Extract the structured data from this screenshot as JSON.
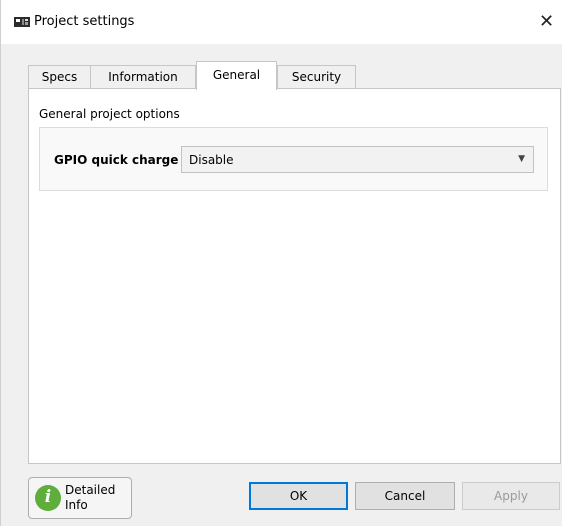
{
  "window": {
    "title": "Project settings",
    "close_glyph": "✕",
    "icon": "chip-board-icon"
  },
  "tabs": [
    {
      "label": "Specs",
      "active": false
    },
    {
      "label": "Information",
      "active": false
    },
    {
      "label": "General",
      "active": true
    },
    {
      "label": "Security",
      "active": false
    }
  ],
  "general": {
    "group_title": "General project options",
    "gpio_label": "GPIO quick charge",
    "gpio_value": "Disable"
  },
  "footer": {
    "info_label": "Detailed Info",
    "info_icon": "info-icon",
    "ok_label": "OK",
    "cancel_label": "Cancel",
    "apply_label": "Apply",
    "apply_enabled": false
  },
  "colors": {
    "accent": "#0078d7",
    "info_green": "#5fae3c"
  }
}
